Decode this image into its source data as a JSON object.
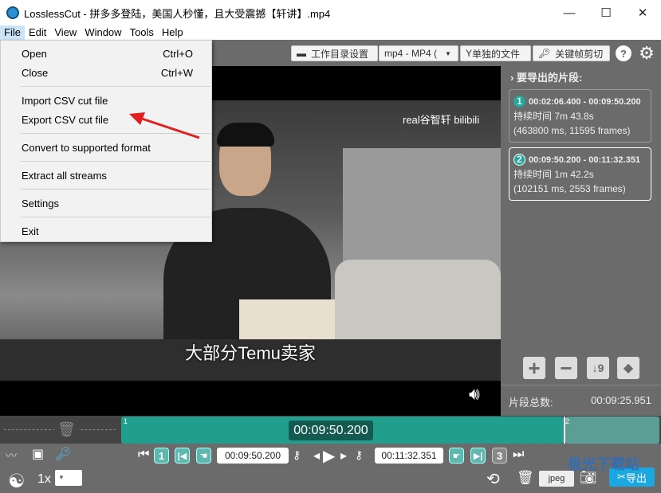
{
  "window": {
    "title": "LosslessCut - 拼多多登陆，美国人秒懂，且大受震撼【轩讲】.mp4",
    "minimize": "—",
    "maximize": "☐",
    "close": "✕"
  },
  "menubar": [
    "File",
    "Edit",
    "View",
    "Window",
    "Tools",
    "Help"
  ],
  "file_menu": [
    {
      "label": "Open",
      "shortcut": "Ctrl+O"
    },
    {
      "label": "Close",
      "shortcut": "Ctrl+W"
    },
    {
      "label": "Import CSV cut file",
      "shortcut": ""
    },
    {
      "label": "Export CSV cut file",
      "shortcut": ""
    },
    {
      "label": "Convert to supported format",
      "shortcut": ""
    },
    {
      "label": "Extract all streams",
      "shortcut": ""
    },
    {
      "label": "Settings",
      "shortcut": ""
    },
    {
      "label": "Exit",
      "shortcut": ""
    }
  ],
  "toolbar": {
    "workdir": "工作目录设置",
    "format": "mp4 - MP4 (",
    "separate": "单独的文件",
    "keyframe": "关键帧剪切",
    "help": "?",
    "settings": "⚙"
  },
  "video": {
    "subtitle": "大部分Temu卖家",
    "watermark": "real谷智轩 bilibili"
  },
  "panel": {
    "header": "要导出的片段:",
    "segments": [
      {
        "n": "1",
        "range": "00:02:06.400 - 00:09:50.200",
        "duration": "持续时间 7m 43.8s",
        "detail": "(463800 ms, 11595 frames)",
        "color": "#26a69a"
      },
      {
        "n": "2",
        "range": "00:09:50.200 - 00:11:32.351",
        "duration": "持续时间 1m 42.2s",
        "detail": "(102151 ms, 2553 frames)",
        "color": "#26a69a"
      }
    ],
    "total_label": "片段总数:",
    "total": "00:09:25.951"
  },
  "timeline": {
    "current": "00:09:50.200",
    "seg1": "1",
    "seg2": "2"
  },
  "controls": {
    "start_time": "00:09:50.200",
    "end_time": "00:11:32.351",
    "seg_num": "1",
    "seg_next": "3",
    "speed": "1x",
    "capture_format": "jpeg",
    "export": "导出"
  },
  "watermark_corner": "极光下载站"
}
